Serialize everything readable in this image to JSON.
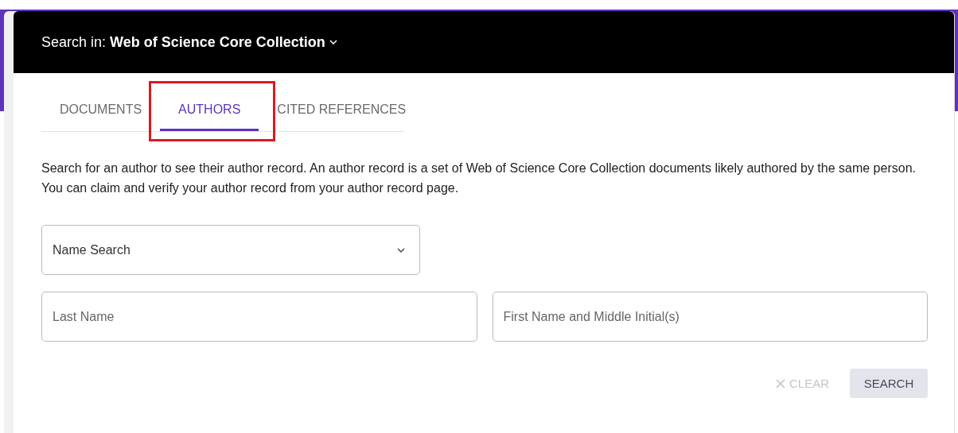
{
  "search_in": {
    "label": "Search in:",
    "collection": "Web of Science Core Collection"
  },
  "tabs": [
    {
      "label": "DOCUMENTS",
      "selected": false,
      "highlighted": false
    },
    {
      "label": "AUTHORS",
      "selected": true,
      "highlighted": true
    },
    {
      "label": "CITED REFERENCES",
      "selected": false,
      "highlighted": false
    }
  ],
  "description": "Search for an author to see their author record. An author record is a set of Web of Science Core Collection documents likely authored by the same person. You can claim and verify your author record from your author record page.",
  "search_type": {
    "value": "Name Search"
  },
  "fields": [
    {
      "placeholder": "Last Name"
    },
    {
      "placeholder": "First Name and Middle Initial(s)"
    }
  ],
  "actions": [
    {
      "kind": "clear",
      "label": "CLEAR",
      "disabled": true
    },
    {
      "kind": "search",
      "label": "SEARCH",
      "disabled": false
    }
  ]
}
